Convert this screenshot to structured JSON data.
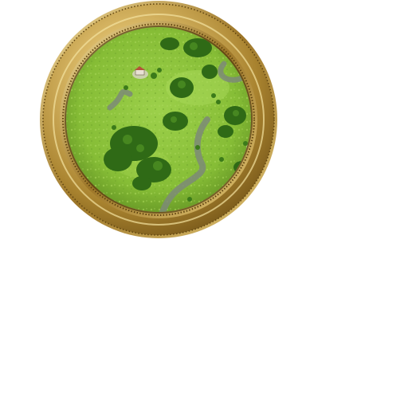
{
  "minimap": {
    "terrain": "grassland",
    "features": [
      "forest",
      "road",
      "building",
      "building"
    ]
  },
  "colors": {
    "frame_gold": "#c9a64a",
    "frame_dark": "#7a5a18",
    "grass": "#8fc43a",
    "forest": "#2f6a16",
    "road": "#7c8a78",
    "building_roof": "#b5523a",
    "building_base": "#d9d4c8"
  }
}
